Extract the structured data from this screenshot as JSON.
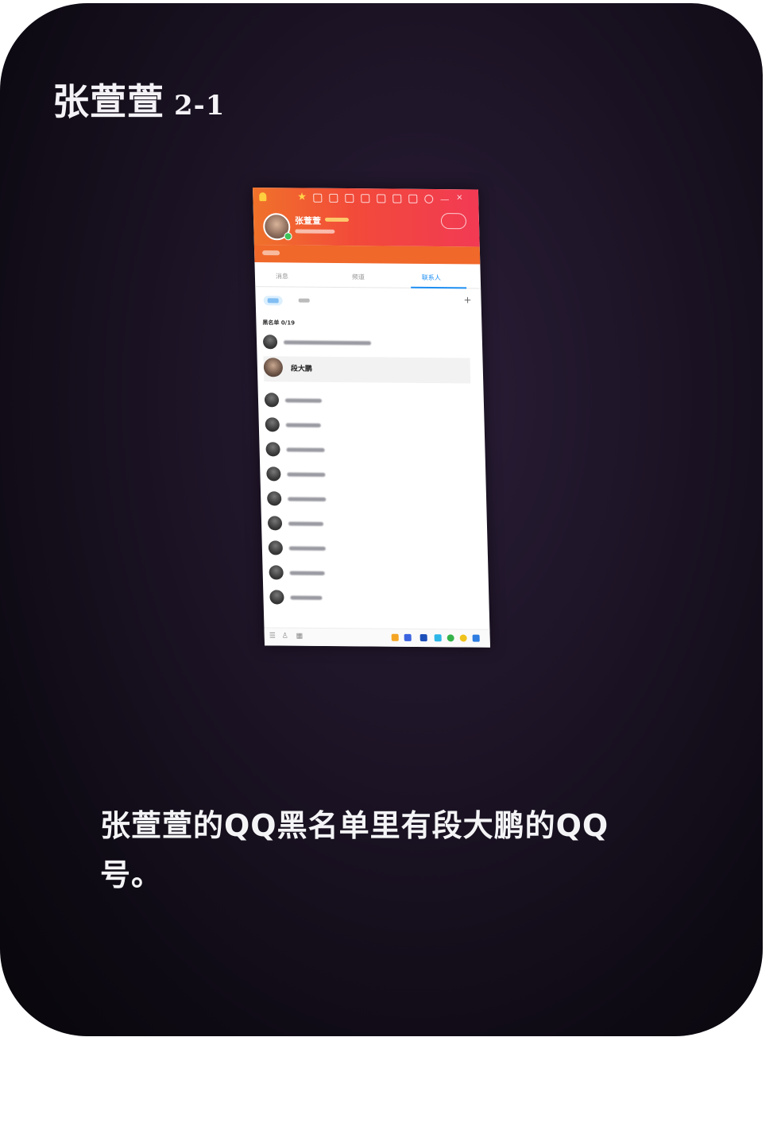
{
  "card": {
    "title": "张萱萱",
    "tag": "2-1",
    "caption": "张萱萱的QQ黑名单里有段大鹏的QQ号。"
  },
  "phone": {
    "profile_name": "张萱萱",
    "tabs": [
      "消息",
      "频道",
      "联系人"
    ],
    "active_tab": "联系人",
    "group_label": "黑名单 0/19",
    "highlighted_contact": "段大鹏",
    "accent_color": "#1e8ff2",
    "header_colors": [
      "#f0722a",
      "#f23a54"
    ]
  }
}
